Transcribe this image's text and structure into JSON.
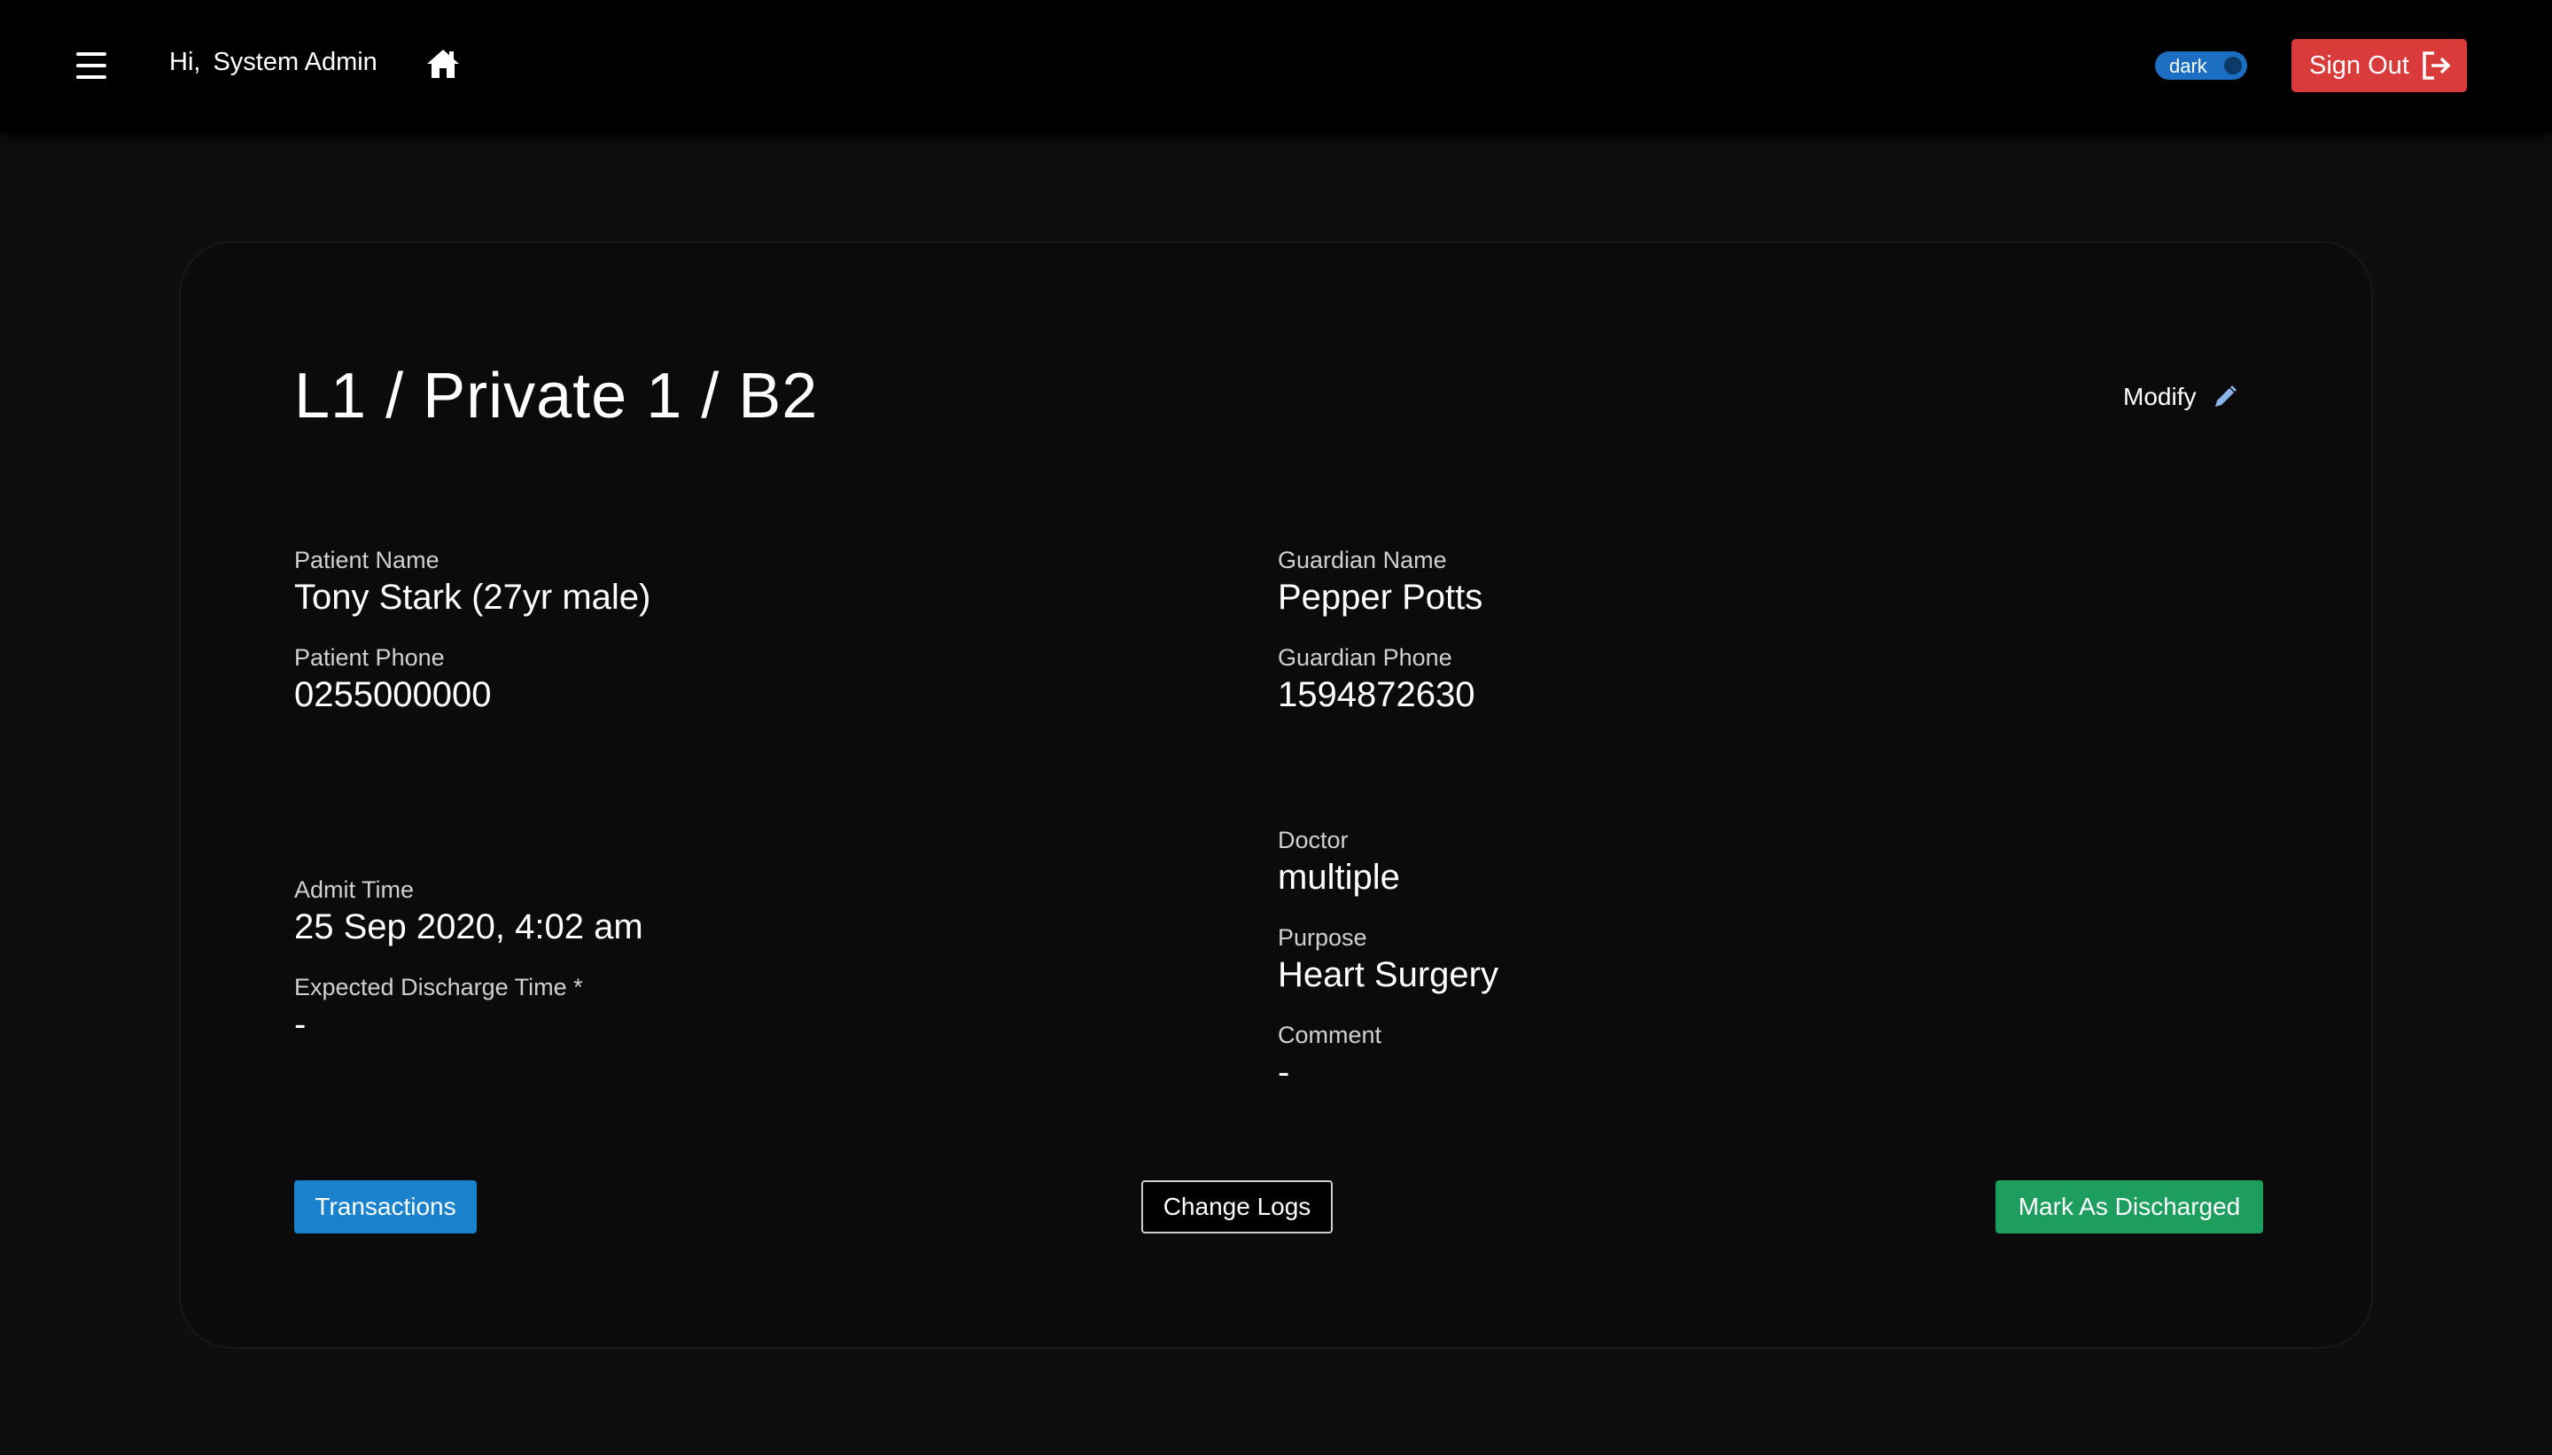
{
  "navbar": {
    "greeting": "Hi,",
    "user_name": "System Admin",
    "theme_toggle_label": "dark",
    "sign_out_label": "Sign Out"
  },
  "bed": {
    "title": "L1 / Private 1 / B2",
    "modify_label": "Modify"
  },
  "patient": {
    "name_label": "Patient Name",
    "name_value": "Tony Stark (27yr male)",
    "phone_label": "Patient Phone",
    "phone_value": "0255000000"
  },
  "guardian": {
    "name_label": "Guardian Name",
    "name_value": "Pepper Potts",
    "phone_label": "Guardian Phone",
    "phone_value": "1594872630"
  },
  "admission": {
    "admit_label": "Admit Time",
    "admit_value": "25 Sep 2020, 4:02 am",
    "discharge_label": "Expected Discharge Time *",
    "discharge_value": "-"
  },
  "details": {
    "doctor_label": "Doctor",
    "doctor_value": "multiple",
    "purpose_label": "Purpose",
    "purpose_value": "Heart Surgery",
    "comment_label": "Comment",
    "comment_value": "-"
  },
  "actions": {
    "transactions_label": "Transactions",
    "change_logs_label": "Change Logs",
    "discharge_label": "Mark As Discharged"
  },
  "colors": {
    "background": "#0e0e0e",
    "navbar": "#000000",
    "sign_out": "#d93a3a",
    "toggle": "#1b6ec2",
    "transactions": "#1a82cc",
    "discharge": "#1e9e5e"
  }
}
